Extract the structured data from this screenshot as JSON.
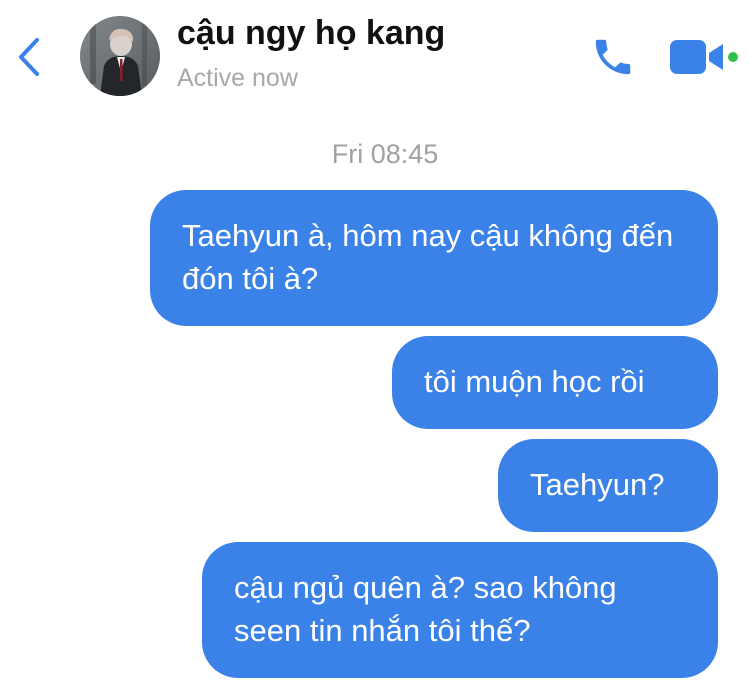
{
  "header": {
    "contact_name": "cậu ngy họ kang",
    "status": "Active now",
    "accent_color": "#3b82e8",
    "online_dot_color": "#31c24d",
    "icons": {
      "back": "chevron-left-icon",
      "call": "phone-icon",
      "video": "video-camera-icon",
      "avatar": "profile-photo"
    }
  },
  "thread": {
    "timestamp": "Fri 08:45",
    "bubble_color": "#3b82e8",
    "messages": [
      {
        "sender": "me",
        "text": "Taehyun à, hôm nay cậu không đến đón tôi à?"
      },
      {
        "sender": "me",
        "text": "tôi muộn học rồi"
      },
      {
        "sender": "me",
        "text": "Taehyun?"
      },
      {
        "sender": "me",
        "text": "cậu ngủ quên à? sao không seen tin nhắn tôi thế?"
      }
    ]
  }
}
